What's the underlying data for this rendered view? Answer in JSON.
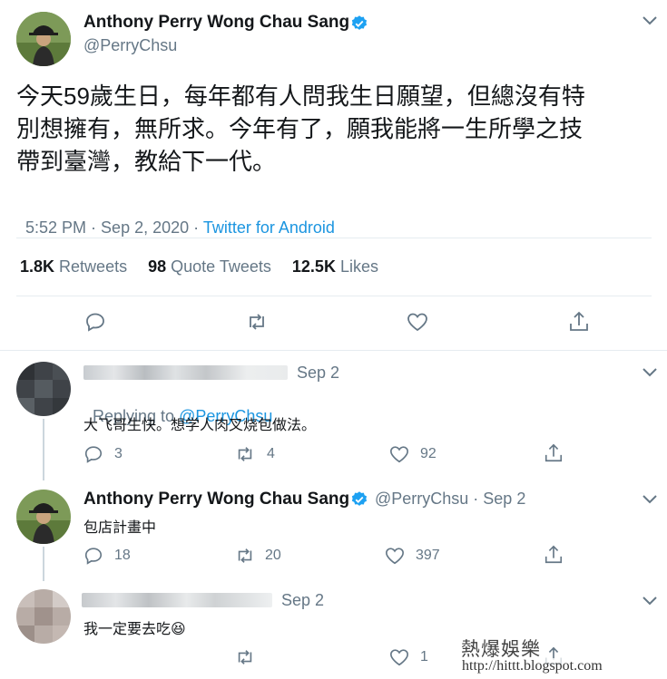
{
  "main_tweet": {
    "author_name": "Anthony Perry Wong Chau Sang",
    "handle": "@PerryChsu",
    "text_line1": "今天59歲生日，每年都有人問我生日願望，但總沒有特",
    "text_line2": "別想擁有，無所求。今年有了，願我能將一生所學之技",
    "text_line3": "帶到臺灣，教給下一代。",
    "time": "5:52 PM · Sep 2, 2020 · ",
    "source": "Twitter for Android",
    "retweets_count": "1.8K",
    "retweets_label": "Retweets",
    "quotes_count": "98",
    "quotes_label": "Quote Tweets",
    "likes_count": "12.5K",
    "likes_label": "Likes"
  },
  "replies": [
    {
      "date": "Sep 2",
      "replying_prefix": "Replying to ",
      "replying_handle": "@PerryChsu",
      "text": "大飞哥生快。想学人肉叉烧包做法。",
      "reply_count": "3",
      "retweet_count": "4",
      "like_count": "92"
    },
    {
      "author_name": "Anthony Perry Wong Chau Sang",
      "handle_date": "@PerryChsu · Sep 2",
      "text": "包店計畫中",
      "reply_count": "18",
      "retweet_count": "20",
      "like_count": "397"
    },
    {
      "date": "Sep 2",
      "text": "我一定要去吃😆",
      "like_count": "1"
    }
  ],
  "watermark": {
    "line1": "熱爆娛樂",
    "line2": "http://hittt.blogspot.com"
  },
  "colors": {
    "verified": "#1da1f2",
    "link": "#1b95e0",
    "muted": "#657786"
  }
}
